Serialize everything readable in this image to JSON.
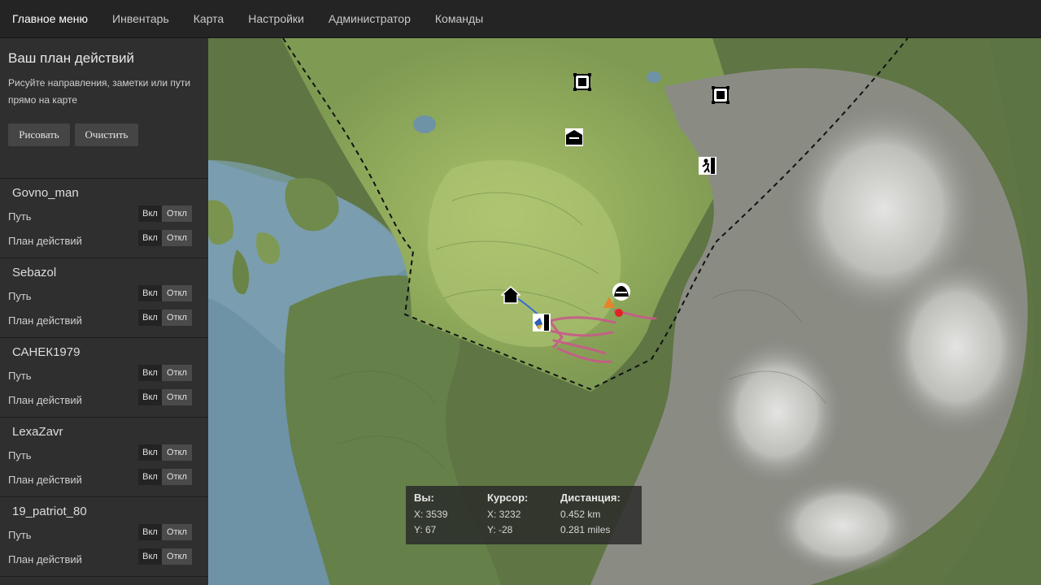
{
  "nav": {
    "items": [
      "Главное меню",
      "Инвентарь",
      "Карта",
      "Настройки",
      "Администратор",
      "Команды"
    ]
  },
  "plan": {
    "title": "Ваш план действий",
    "hint": "Рисуйте направления, заметки или пути прямо на карте",
    "draw_label": "Рисовать",
    "clear_label": "Очистить"
  },
  "toggle": {
    "on": "Вкл",
    "off": "Откл"
  },
  "row_labels": {
    "path": "Путь",
    "plan": "План действий"
  },
  "players": [
    {
      "name": "Govno_man"
    },
    {
      "name": "Sebazol"
    },
    {
      "name": "САНЕК1979"
    },
    {
      "name": "LexaZavr"
    },
    {
      "name": "19_patriot_80"
    }
  ],
  "info": {
    "you": {
      "label": "Вы:",
      "x": "X: 3539",
      "y": "Y: 67"
    },
    "cursor": {
      "label": "Курсор:",
      "x": "X: 3232",
      "y": "Y: -28"
    },
    "distance": {
      "label": "Дистанция:",
      "km": "0.452 km",
      "miles": "0.281 miles"
    }
  },
  "colors": {
    "water": "#6e93a6",
    "grass": "#8aa55a",
    "forest": "#5f7a45",
    "rock": "#8c8c86",
    "snow": "#d8d8d6",
    "route": "#c85a8a",
    "marker": "#e02424"
  },
  "map_icons": [
    "fort-icon",
    "fort-icon",
    "bunker-icon",
    "climb-icon",
    "house-icon",
    "player-icon",
    "tent-icon"
  ]
}
